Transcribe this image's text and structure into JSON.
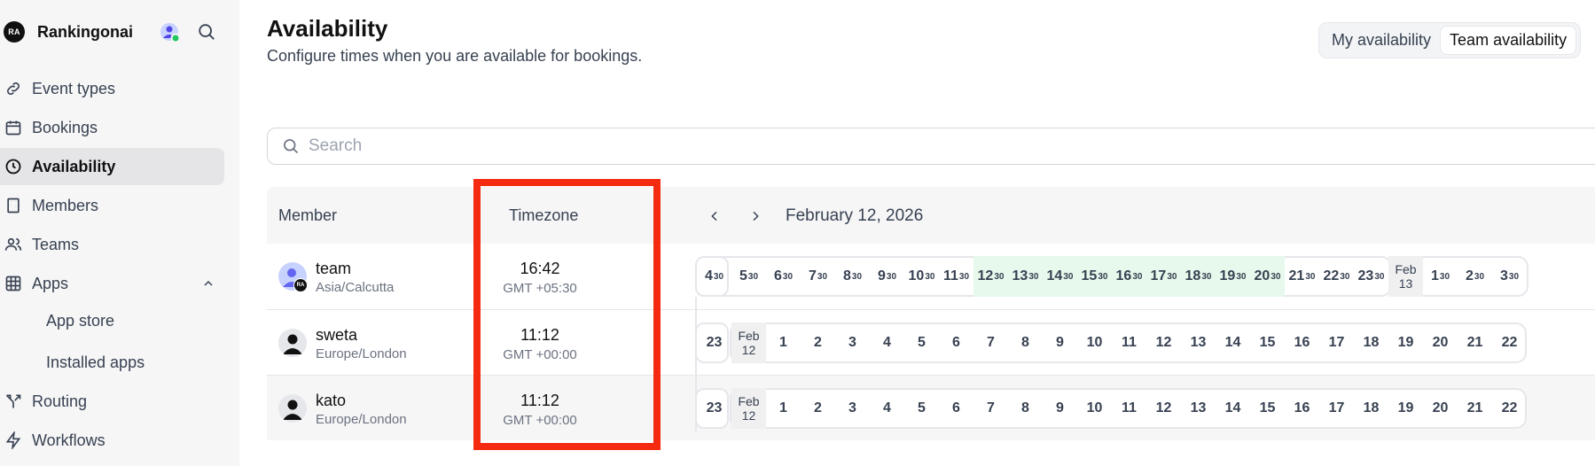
{
  "brand": {
    "initials": "RA",
    "name": "Rankingonai"
  },
  "nav": {
    "items": [
      {
        "label": "Event types",
        "icon": "link-icon"
      },
      {
        "label": "Bookings",
        "icon": "calendar-icon"
      },
      {
        "label": "Availability",
        "icon": "clock-icon",
        "active": true
      },
      {
        "label": "Members",
        "icon": "building-icon"
      },
      {
        "label": "Teams",
        "icon": "users-icon"
      },
      {
        "label": "Apps",
        "icon": "grid-icon"
      },
      {
        "label": "Routing",
        "icon": "split-icon"
      },
      {
        "label": "Workflows",
        "icon": "zap-icon"
      }
    ],
    "apps_sub": [
      "App store",
      "Installed apps"
    ]
  },
  "header": {
    "title": "Availability",
    "subtitle": "Configure times when you are available for bookings.",
    "toggle": [
      "My availability",
      "Team availability"
    ],
    "toggle_active": 1
  },
  "search": {
    "placeholder": "Search"
  },
  "table": {
    "col_member": "Member",
    "col_timezone": "Timezone",
    "date": "February 12, 2026",
    "rows": [
      {
        "name": "team",
        "tz": "Asia/Calcutta",
        "time": "16:42",
        "offset": "GMT +05:30",
        "badge": "RA"
      },
      {
        "name": "sweta",
        "tz": "Europe/London",
        "time": "11:12",
        "offset": "GMT +00:00"
      },
      {
        "name": "kato",
        "tz": "Europe/London",
        "time": "11:12",
        "offset": "GMT +00:00"
      }
    ]
  },
  "timeline": {
    "team": {
      "first": "4",
      "hours": [
        "5",
        "6",
        "7",
        "8",
        "9",
        "10",
        "11",
        "12",
        "13",
        "14",
        "15",
        "16",
        "17",
        "18",
        "19",
        "20",
        "21",
        "22",
        "23"
      ],
      "available": [
        "12",
        "13",
        "14",
        "15",
        "16",
        "17",
        "18",
        "19",
        "20"
      ],
      "day_break": [
        "Feb",
        "13"
      ],
      "after": [
        "1",
        "2",
        "3"
      ],
      "minutes": "30"
    },
    "uk": {
      "first": "23",
      "day_break": [
        "Feb",
        "12"
      ],
      "hours": [
        "1",
        "2",
        "3",
        "4",
        "5",
        "6",
        "7",
        "8",
        "9",
        "10",
        "11",
        "12",
        "13",
        "14",
        "15",
        "16",
        "17",
        "18",
        "19",
        "20",
        "21",
        "22"
      ]
    }
  },
  "colors": {
    "highlight": "#f52b11",
    "available": "#e7f8ec",
    "online": "#22c55e"
  }
}
